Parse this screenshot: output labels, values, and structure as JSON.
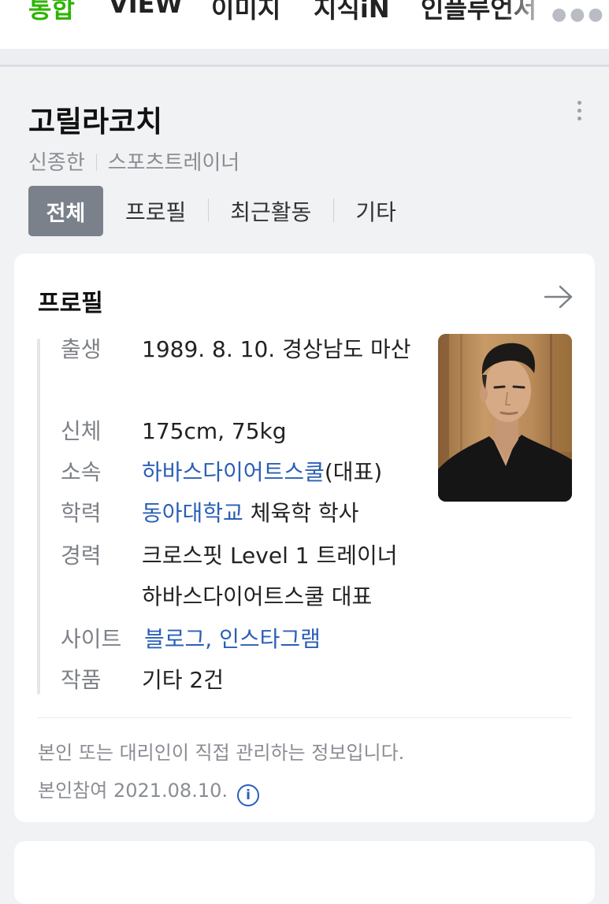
{
  "top_tabs": [
    {
      "label": "통합",
      "active": true
    },
    {
      "label": "VIEW",
      "active": false
    },
    {
      "label": "이미지",
      "active": false
    },
    {
      "label": "지식iN",
      "active": false
    },
    {
      "label": "인플루언서",
      "active": false
    }
  ],
  "top_more_icon": "more-dots-icon",
  "entity": {
    "name": "고릴라코치",
    "real_name": "신종한",
    "occupation": "스포츠트레이너"
  },
  "chips": {
    "all": "전체",
    "profile": "프로필",
    "recent": "최근활동",
    "etc": "기타"
  },
  "profile": {
    "title": "프로필",
    "birth_label": "출생",
    "birth_value": "1989. 8. 10. 경상남도 마산",
    "body_label": "신체",
    "body_value": "175cm, 75kg",
    "affiliation_label": "소속",
    "affiliation_link": "하바스다이어트스쿨",
    "affiliation_suffix": "(대표)",
    "education_label": "학력",
    "education_link": "동아대학교",
    "education_suffix": " 체육학 학사",
    "career_label": "경력",
    "career_line1": "크로스핏 Level 1 트레이너",
    "career_line2": "하바스다이어트스쿨 대표",
    "site_label": "사이트",
    "site_link1": "블로그",
    "site_sep": ", ",
    "site_link2": "인스타그램",
    "works_label": "작품",
    "works_value": "기타 2건",
    "note1": "본인 또는 대리인이 직접 관리하는 정보입니다.",
    "note2": "본인참여 2021.08.10."
  },
  "colors": {
    "accent_green": "#2db400",
    "link_blue": "#2b5fb5",
    "chip_active_bg": "#7b818b"
  }
}
